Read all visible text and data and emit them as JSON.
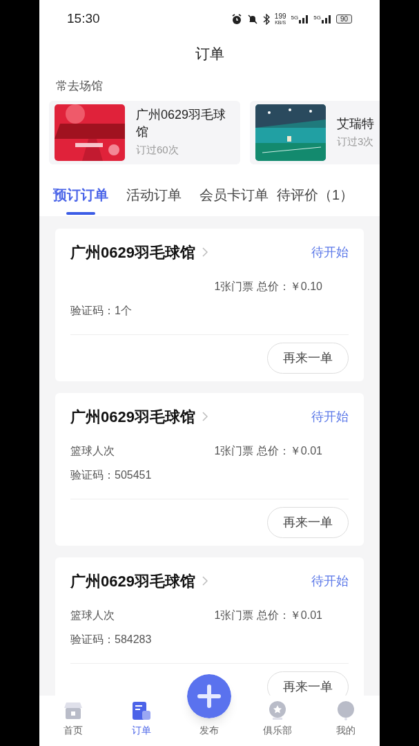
{
  "status_bar": {
    "time": "15:30",
    "speed": "199",
    "speed_unit": "KB/S",
    "net1": "5G",
    "net2": "5G",
    "battery": "90"
  },
  "title": "订单",
  "frequent": {
    "heading": "常去场馆",
    "venues": [
      {
        "name": "广州0629羽毛球馆",
        "count": "订过60次"
      },
      {
        "name": "艾瑞特",
        "count": "订过3次"
      }
    ]
  },
  "tabs": [
    {
      "label": "预订订单",
      "selected": true
    },
    {
      "label": "活动订单",
      "selected": false
    },
    {
      "label": "会员卡订单",
      "selected": false
    },
    {
      "label": "待评价（1）",
      "selected": false
    }
  ],
  "orders": [
    {
      "venue": "广州0629羽毛球馆",
      "status": "待开始",
      "price": "1张门票 总价：￥0.10",
      "code": "验证码：1个",
      "button": "再来一单"
    },
    {
      "venue": "广州0629羽毛球馆",
      "status": "待开始",
      "item": "篮球人次",
      "price": "1张门票 总价：￥0.01",
      "code": "验证码：505451",
      "button": "再来一单"
    },
    {
      "venue": "广州0629羽毛球馆",
      "status": "待开始",
      "item": "篮球人次",
      "price": "1张门票 总价：￥0.01",
      "code": "验证码：584283",
      "button": "再来一单"
    }
  ],
  "nav": [
    {
      "kind": "home",
      "label": "首页",
      "selected": false
    },
    {
      "kind": "orders",
      "label": "订单",
      "selected": true
    },
    {
      "kind": "publish",
      "label": "发布",
      "selected": false
    },
    {
      "kind": "club",
      "label": "俱乐部",
      "selected": false
    },
    {
      "kind": "me",
      "label": "我的",
      "selected": false
    }
  ]
}
